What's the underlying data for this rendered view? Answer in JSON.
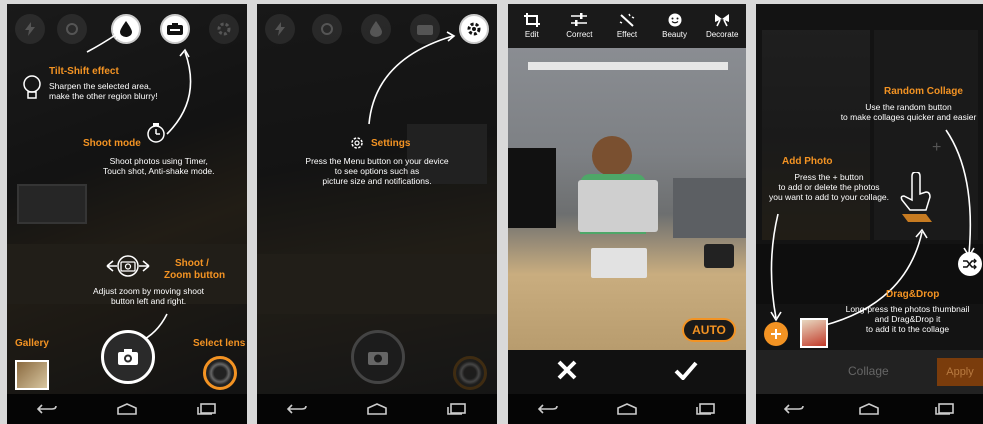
{
  "panel1": {
    "tiltshift_title": "Tilt-Shift effect",
    "tiltshift_desc_1": "Sharpen the selected area,",
    "tiltshift_desc_2": "make the other region blurry!",
    "shootmode_title": "Shoot mode",
    "shootmode_desc_1": "Shoot photos using Timer,",
    "shootmode_desc_2": "Touch shot, Anti-shake mode.",
    "zoom_title_1": "Shoot /",
    "zoom_title_2": "Zoom button",
    "zoom_desc_1": "Adjust zoom by moving shoot",
    "zoom_desc_2": "button left and right.",
    "gallery_label": "Gallery",
    "lens_label": "Select lens"
  },
  "panel2": {
    "settings_title": "Settings",
    "settings_desc_1": "Press the Menu button on your device",
    "settings_desc_2": "to see options such as",
    "settings_desc_3": "picture size and notifications."
  },
  "panel3": {
    "toolbar": [
      {
        "label": "Edit",
        "icon": "crop-icon"
      },
      {
        "label": "Correct",
        "icon": "sliders-icon"
      },
      {
        "label": "Effect",
        "icon": "magic-wand-icon"
      },
      {
        "label": "Beauty",
        "icon": "smiley-icon"
      },
      {
        "label": "Decorate",
        "icon": "bow-icon"
      }
    ],
    "auto_label": "AUTO"
  },
  "panel4": {
    "random_title": "Random Collage",
    "random_desc_1": "Use the random button",
    "random_desc_2": "to make collages quicker and easier",
    "addphoto_title": "Add Photo",
    "addphoto_desc_1": "Press the + button",
    "addphoto_desc_2": "to add or delete the photos",
    "addphoto_desc_3": "you want to add to your collage.",
    "drag_title": "Drag&Drop",
    "drag_desc_1": "Long-press the photos thumbnail",
    "drag_desc_2": "and Drag&Drop it",
    "drag_desc_3": "to add it to the collage",
    "collage_label": "Collage",
    "apply_label": "Apply"
  },
  "colors": {
    "accent": "#f39323",
    "nav": "#050505"
  }
}
